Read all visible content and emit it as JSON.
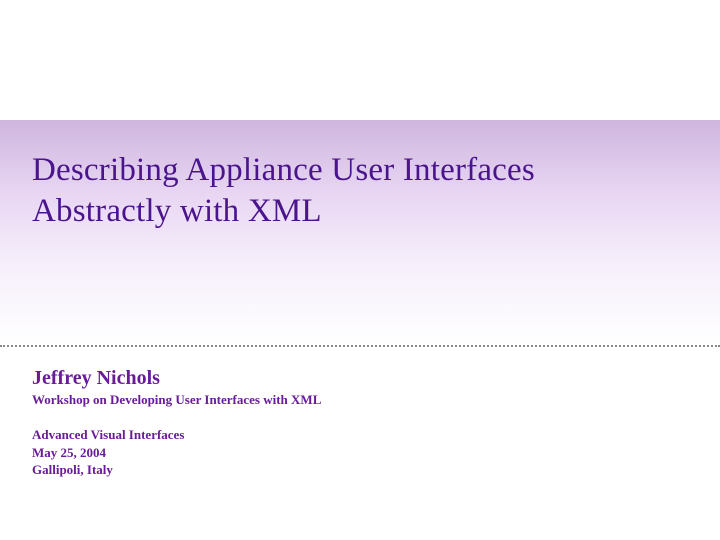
{
  "slide": {
    "title": "Describing Appliance User Interfaces Abstractly with XML",
    "author": "Jeffrey Nichols",
    "workshop": "Workshop on Developing User Interfaces with XML",
    "venue": "Advanced Visual Interfaces",
    "date": "May 25, 2004",
    "location": "Gallipoli, Italy"
  }
}
